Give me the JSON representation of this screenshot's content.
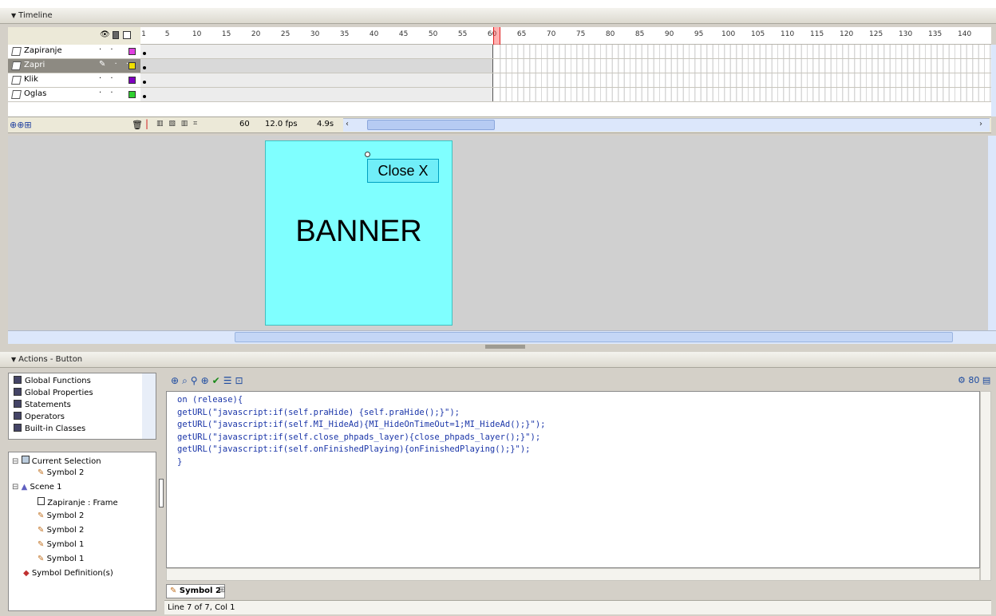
{
  "timeline": {
    "title": "Timeline",
    "layers": [
      {
        "name": "Zapiranje",
        "color": "#e040e0",
        "selected": false
      },
      {
        "name": "Zapri",
        "color": "#f0e000",
        "selected": true
      },
      {
        "name": "Klik",
        "color": "#8000c0",
        "selected": false
      },
      {
        "name": "Oglas",
        "color": "#30d030",
        "selected": false
      }
    ],
    "ruler_numbers": [
      "1",
      "5",
      "10",
      "15",
      "20",
      "25",
      "30",
      "35",
      "40",
      "45",
      "50",
      "55",
      "60",
      "65",
      "70",
      "75",
      "80",
      "85",
      "90",
      "95",
      "100",
      "105",
      "110",
      "115",
      "120",
      "125",
      "130",
      "135",
      "140"
    ],
    "current_frame": "60",
    "frame_rate": "12.0 fps",
    "elapsed": "4.9s"
  },
  "stage": {
    "banner_text": "BANNER",
    "close_text": "Close X",
    "banner_color": "#7fffff"
  },
  "actions": {
    "title": "Actions - Button",
    "toolbox": [
      "Global Functions",
      "Global Properties",
      "Statements",
      "Operators",
      "Built-in Classes"
    ],
    "tree": {
      "current_selection": "Current Selection",
      "current_symbol": "Symbol 2",
      "scene": "Scene 1",
      "frame_item": "Zapiranje : Frame",
      "symbols": [
        "Symbol 2",
        "Symbol 2",
        "Symbol 1",
        "Symbol 1"
      ],
      "definitions": "Symbol Definition(s)"
    },
    "code": [
      "on (release){",
      "getURL(\"javascript:if(self.praHide) {self.praHide();}\");",
      "getURL(\"javascript:if(self.MI_HideAd){MI_HideOnTimeOut=1;MI_HideAd();}\");",
      "getURL(\"javascript:if(self.close_phpads_layer){close_phpads_layer();}\");",
      "getURL(\"javascript:if(self.onFinishedPlaying){onFinishedPlaying();}\");",
      "}"
    ],
    "tab_label": "Symbol 2",
    "status": "Line 7 of 7, Col 1"
  }
}
